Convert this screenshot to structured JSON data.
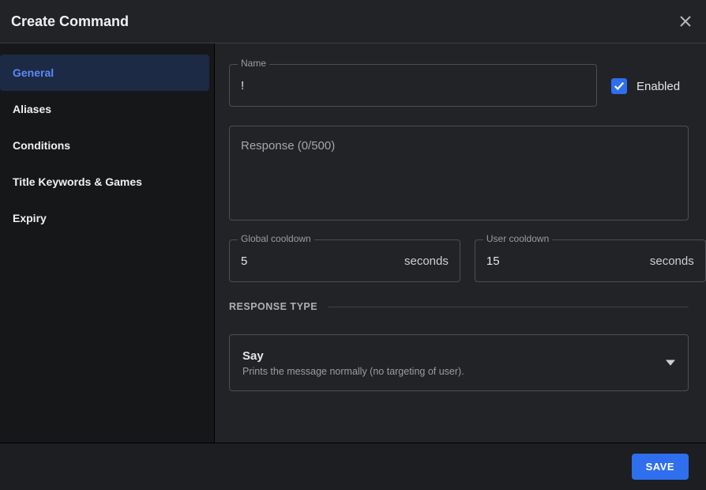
{
  "header": {
    "title": "Create Command"
  },
  "sidebar": {
    "tabs": [
      {
        "label": "General",
        "active": true
      },
      {
        "label": "Aliases",
        "active": false
      },
      {
        "label": "Conditions",
        "active": false
      },
      {
        "label": "Title Keywords & Games",
        "active": false
      },
      {
        "label": "Expiry",
        "active": false
      }
    ]
  },
  "form": {
    "name": {
      "label": "Name",
      "value": "!"
    },
    "enabled": {
      "label": "Enabled",
      "checked": true
    },
    "response": {
      "placeholder": "Response (0/500)"
    },
    "global_cooldown": {
      "label": "Global cooldown",
      "value": "5",
      "suffix": "seconds"
    },
    "user_cooldown": {
      "label": "User cooldown",
      "value": "15",
      "suffix": "seconds"
    },
    "response_type": {
      "section_label": "RESPONSE TYPE",
      "selected": {
        "title": "Say",
        "desc": "Prints the message normally (no targeting of user)."
      }
    }
  },
  "footer": {
    "save_label": "SAVE"
  }
}
